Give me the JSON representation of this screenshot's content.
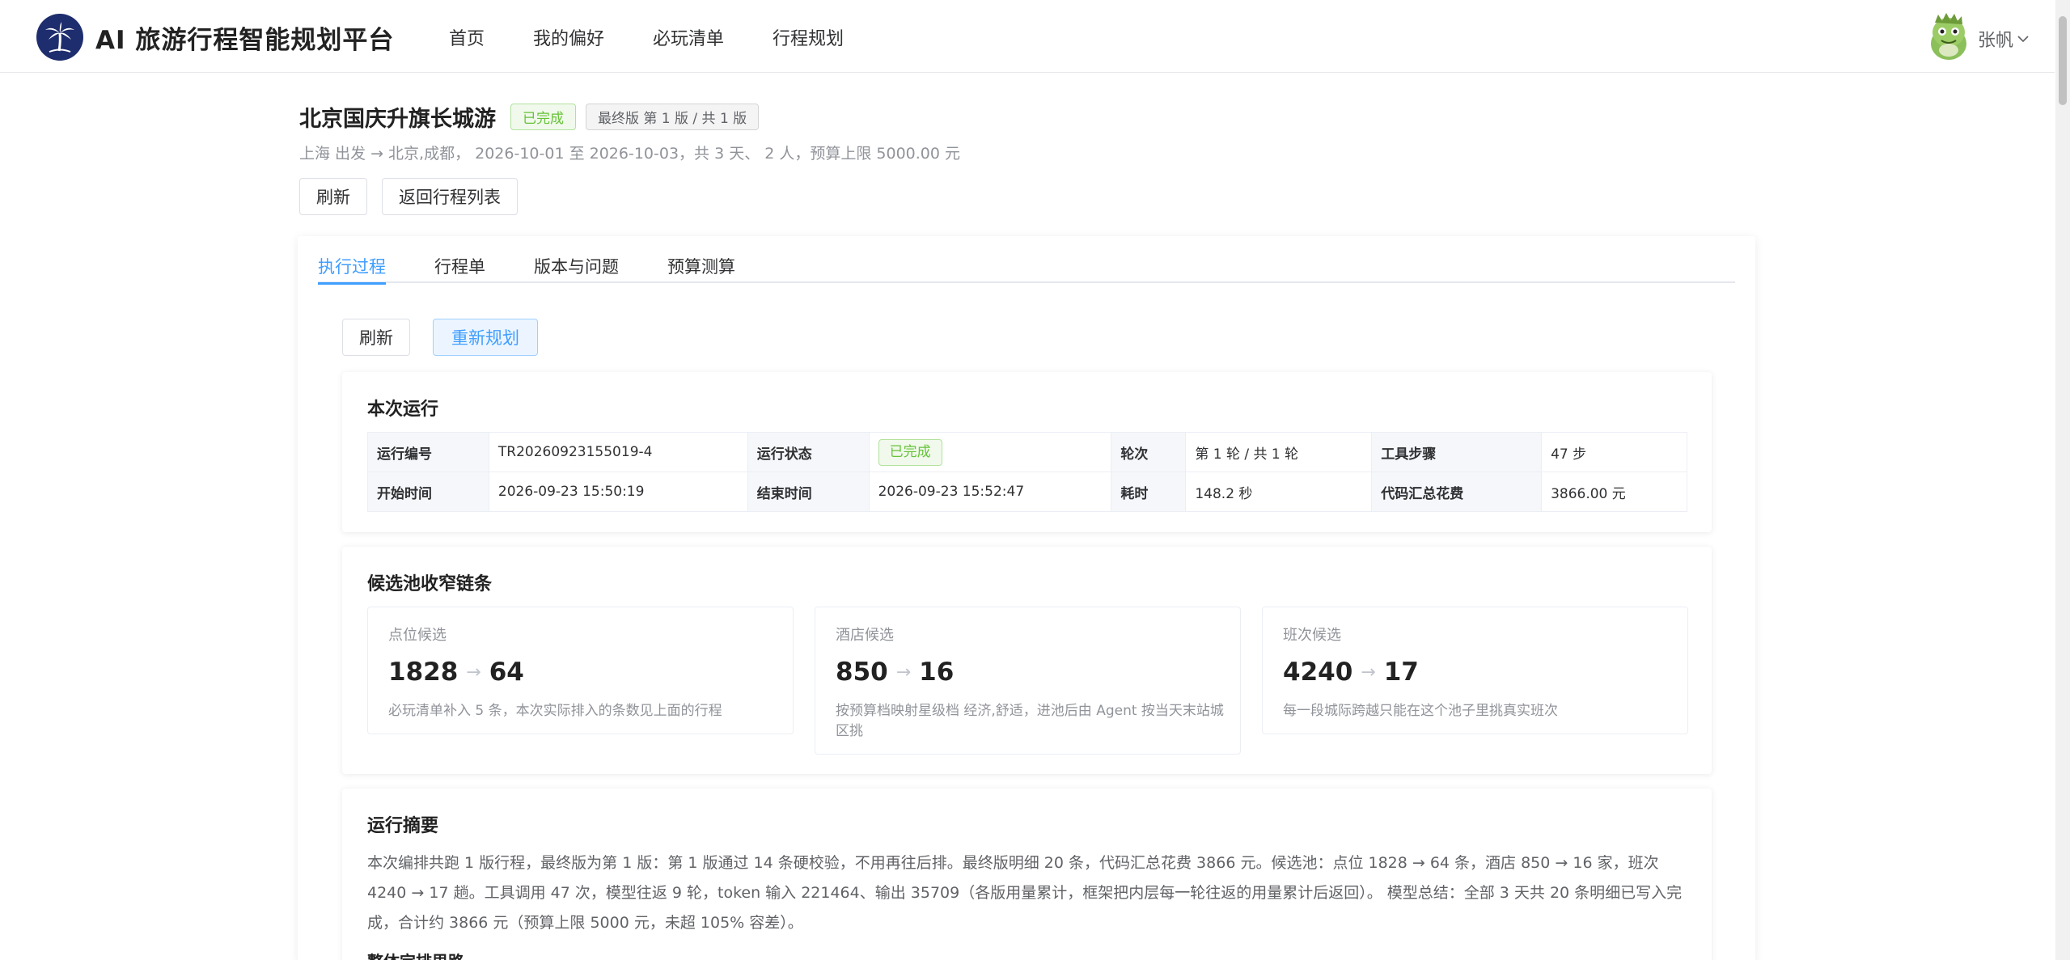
{
  "header": {
    "brand": "AI 旅游行程智能规划平台",
    "nav": [
      "首页",
      "我的偏好",
      "必玩清单",
      "行程规划"
    ],
    "user_name": "张帆",
    "brand_color": "#1e2d6e"
  },
  "trip": {
    "title": "北京国庆升旗长城游",
    "status_badge": "已完成",
    "version_badge": "最终版 第 1 版 / 共 1 版",
    "subtitle": "上海 出发 → 北京,成都， 2026-10-01 至 2026-10-03，共 3 天、 2 人，预算上限 5000.00 元",
    "refresh_label": "刷新",
    "back_label": "返回行程列表"
  },
  "tabs": [
    {
      "label": "执行过程",
      "active": true
    },
    {
      "label": "行程单",
      "active": false
    },
    {
      "label": "版本与问题",
      "active": false
    },
    {
      "label": "预算测算",
      "active": false
    }
  ],
  "actions": {
    "refresh_label": "刷新",
    "replan_label": "重新规划"
  },
  "run": {
    "title": "本次运行",
    "rows": [
      [
        {
          "label": "运行编号",
          "value": "TR20260923155019-4"
        },
        {
          "label": "运行状态",
          "value": "已完成",
          "tag": true
        },
        {
          "label": "轮次",
          "value": "第 1 轮 / 共 1 轮"
        },
        {
          "label": "工具步骤",
          "value": "47 步"
        }
      ],
      [
        {
          "label": "开始时间",
          "value": "2026-09-23 15:50:19"
        },
        {
          "label": "结束时间",
          "value": "2026-09-23 15:52:47"
        },
        {
          "label": "耗时",
          "value": "148.2 秒"
        },
        {
          "label": "代码汇总花费",
          "value": "3866.00 元"
        }
      ]
    ]
  },
  "pools": {
    "title": "候选池收窄链条",
    "items": [
      {
        "label": "点位候选",
        "from": "1828",
        "to": "64",
        "desc": "必玩清单补入 5 条，本次实际排入的条数见上面的行程"
      },
      {
        "label": "酒店候选",
        "from": "850",
        "to": "16",
        "desc": "按预算档映射星级档 经济,舒适，进池后由 Agent 按当天末站城区挑"
      },
      {
        "label": "班次候选",
        "from": "4240",
        "to": "17",
        "desc": "每一段城际跨越只能在这个池子里挑真实班次"
      }
    ]
  },
  "summary": {
    "title": "运行摘要",
    "text": "本次编排共跑 1 版行程，最终版为第 1 版：第 1 版通过 14 条硬校验，不用再往后排。最终版明细 20 条，代码汇总花费 3866 元。候选池：点位 1828 → 64 条，酒店 850 → 16 家，班次 4240 → 17 趟。工具调用 47 次，模型往返 9 轮，token 输入 221464、输出 35709（各版用量累计，框架把内层每一轮往返的用量累计后返回）。 模型总结：全部 3 天共 20 条明细已写入完成，合计约 3866 元（预算上限 5000 元，未超 105% 容差）。",
    "next_heading": "整体定排思路"
  }
}
